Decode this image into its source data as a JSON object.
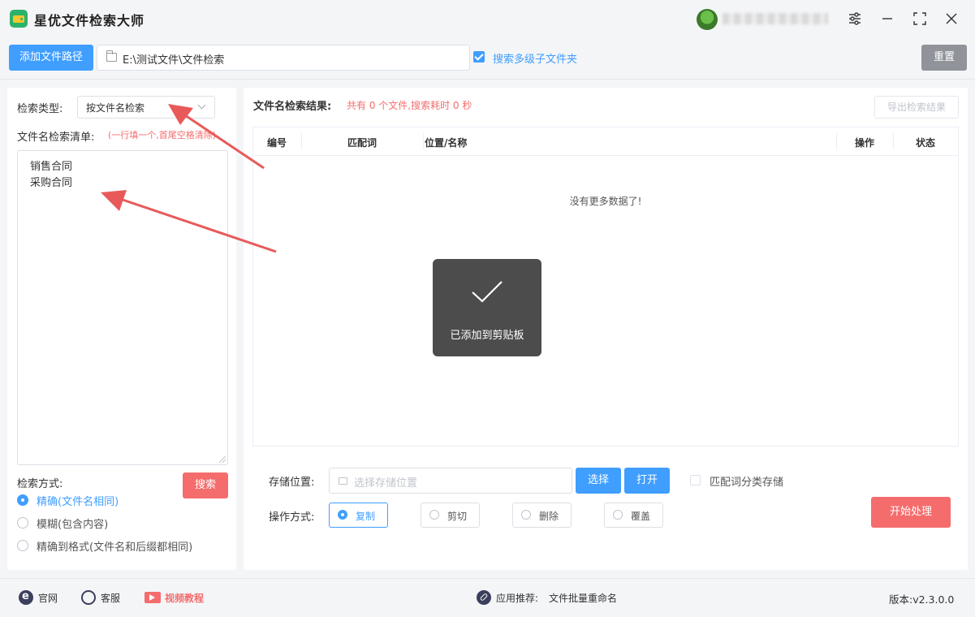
{
  "app": {
    "title": "星优文件检索大师"
  },
  "window": {
    "settings_icon": "sliders-icon",
    "minimize_icon": "minimize-icon",
    "maximize_icon": "maximize-icon",
    "close_icon": "close-icon"
  },
  "toolbar": {
    "add_path_label": "添加文件路径",
    "path_value": "E:\\测试文件\\文件检索",
    "include_subfolders_label": "搜索多级子文件夹",
    "include_subfolders_checked": true,
    "reset_label": "重置"
  },
  "left": {
    "search_type_label": "检索类型:",
    "search_type_value": "按文件名检索",
    "list_label": "文件名检索清单:",
    "list_hint": "(一行填一个,首尾空格清除)",
    "list_lines": [
      "销售合同",
      "采购合同"
    ],
    "mode_label": "检索方式:",
    "search_button": "搜索",
    "modes": [
      {
        "label": "精确(文件名相同)",
        "selected": true
      },
      {
        "label": "模糊(包含内容)",
        "selected": false
      },
      {
        "label": "精确到格式(文件名和后缀都相同)",
        "selected": false
      }
    ]
  },
  "results": {
    "label": "文件名检索结果:",
    "summary": "共有 0 个文件,搜索耗时 0 秒",
    "export_label": "导出检索结果",
    "columns": [
      "编号",
      "匹配词",
      "位置/名称",
      "操作",
      "状态"
    ],
    "empty_text": "没有更多数据了!"
  },
  "storage": {
    "label": "存储位置:",
    "placeholder": "选择存储位置",
    "choose_label": "选择",
    "open_label": "打开",
    "classify_label": "匹配词分类存储",
    "classify_checked": false
  },
  "operation": {
    "label": "操作方式:",
    "options": [
      {
        "label": "复制",
        "selected": true
      },
      {
        "label": "剪切",
        "selected": false
      },
      {
        "label": "删除",
        "selected": false
      },
      {
        "label": "覆盖",
        "selected": false
      }
    ],
    "start_label": "开始处理"
  },
  "toast": {
    "text": "已添加到剪贴板"
  },
  "footer": {
    "website": "官网",
    "support": "客服",
    "video": "视频教程",
    "recommend_label": "应用推荐:",
    "recommend_app": "文件批量重命名",
    "version": "版本:v2.3.0.0"
  },
  "colors": {
    "primary": "#409eff",
    "danger": "#f56c6c",
    "gray_button": "#909399",
    "arrow": "#e85a5a"
  }
}
